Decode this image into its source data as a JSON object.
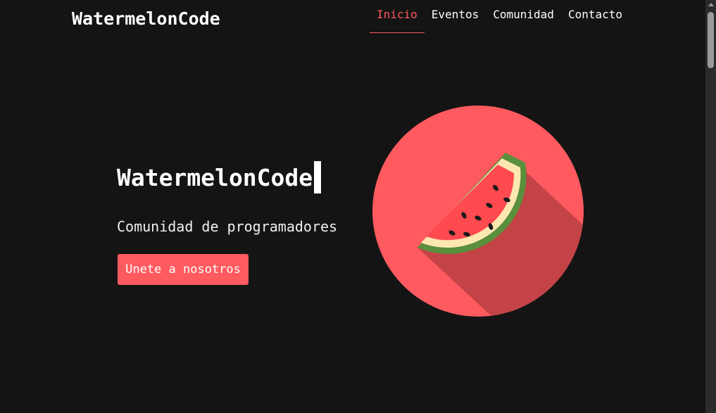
{
  "header": {
    "brand": "WatermelonCode",
    "nav": [
      {
        "label": "Inicio",
        "active": true
      },
      {
        "label": "Eventos",
        "active": false
      },
      {
        "label": "Comunidad",
        "active": false
      },
      {
        "label": "Contacto",
        "active": false
      }
    ]
  },
  "hero": {
    "title": "WatermelonCode",
    "subtitle": "Comunidad de programadores",
    "cta_label": "Unete a nosotros",
    "illustration_icon": "watermelon-slice-icon"
  },
  "colors": {
    "background": "#141414",
    "accent": "#ff5a5f",
    "circle": "#ff5a5f",
    "shadow": "#c44347",
    "rind_green": "#5a8f3c",
    "rind_cream": "#fde7b0",
    "flesh": "#ff4a4f",
    "seed": "#1a1a1a"
  }
}
